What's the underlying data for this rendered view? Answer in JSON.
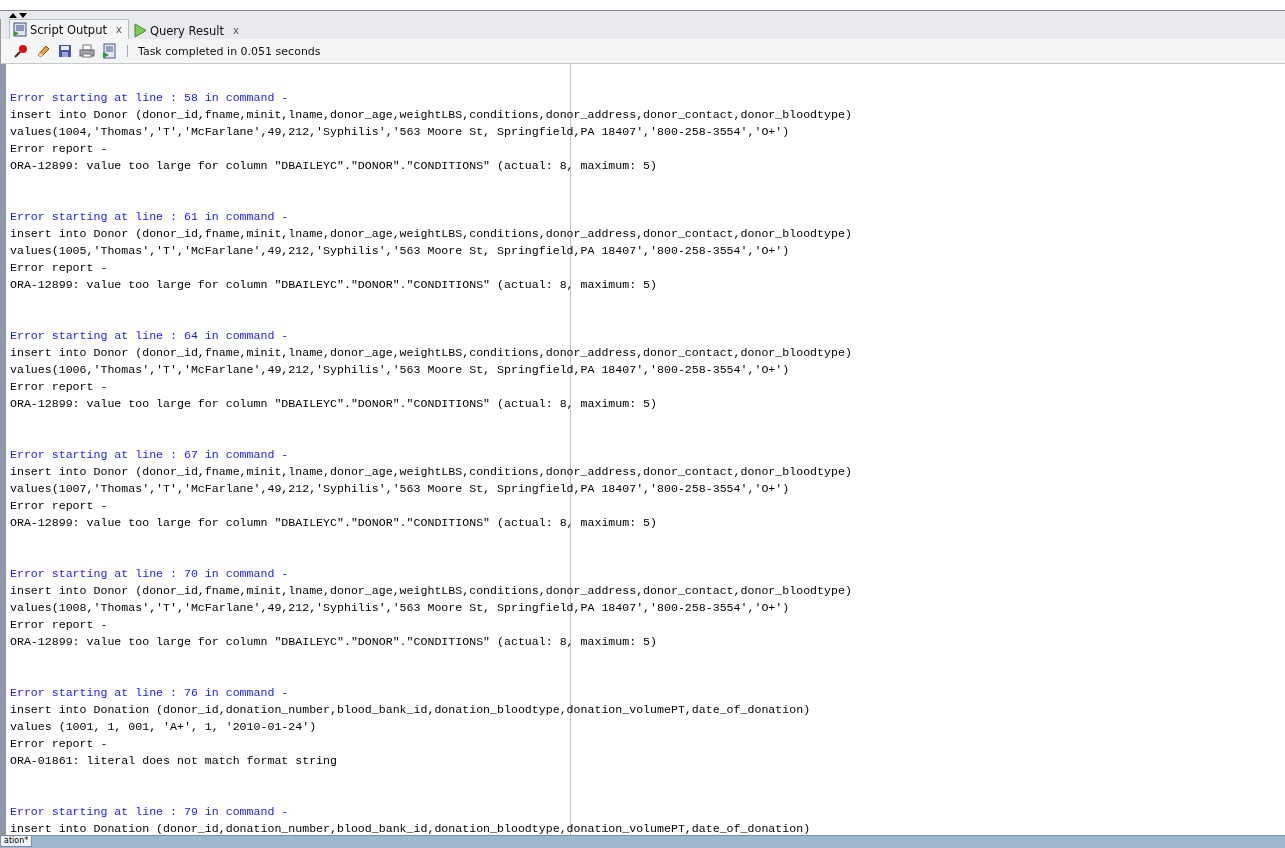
{
  "tabs": [
    {
      "label": "Script Output",
      "close": "x",
      "kind": "script",
      "selected": true
    },
    {
      "label": "Query Result",
      "close": "x",
      "kind": "play",
      "selected": false
    }
  ],
  "toolbar": {
    "tools": [
      {
        "kind": "pin"
      },
      {
        "kind": "eraser"
      },
      {
        "kind": "save"
      },
      {
        "kind": "print"
      },
      {
        "kind": "run"
      }
    ],
    "status": "Task completed in 0.051 seconds"
  },
  "output": [
    {
      "lines": [
        {
          "kind": "heading",
          "text": "Error starting at line : 58 in command -"
        },
        {
          "kind": "code",
          "text": "insert into Donor (donor_id,fname,minit,lname,donor_age,weightLBS,conditions,donor_address,donor_contact,donor_bloodtype)"
        },
        {
          "kind": "code",
          "text": "values(1004,'Thomas','T','McFarlane',49,212,'Syphilis','563 Moore St, Springfield,PA 18407','800-258-3554','O+')"
        },
        {
          "kind": "code",
          "text": "Error report -"
        },
        {
          "kind": "code",
          "text": "ORA-12899: value too large for column \"DBAILEYC\".\"DONOR\".\"CONDITIONS\" (actual: 8, maximum: 5)"
        }
      ]
    },
    {
      "lines": [
        {
          "kind": "heading",
          "text": "Error starting at line : 61 in command -"
        },
        {
          "kind": "code",
          "text": "insert into Donor (donor_id,fname,minit,lname,donor_age,weightLBS,conditions,donor_address,donor_contact,donor_bloodtype)"
        },
        {
          "kind": "code",
          "text": "values(1005,'Thomas','T','McFarlane',49,212,'Syphilis','563 Moore St, Springfield,PA 18407','800-258-3554','O+')"
        },
        {
          "kind": "code",
          "text": "Error report -"
        },
        {
          "kind": "code",
          "text": "ORA-12899: value too large for column \"DBAILEYC\".\"DONOR\".\"CONDITIONS\" (actual: 8, maximum: 5)"
        }
      ]
    },
    {
      "lines": [
        {
          "kind": "heading",
          "text": "Error starting at line : 64 in command -"
        },
        {
          "kind": "code",
          "text": "insert into Donor (donor_id,fname,minit,lname,donor_age,weightLBS,conditions,donor_address,donor_contact,donor_bloodtype)"
        },
        {
          "kind": "code",
          "text": "values(1006,'Thomas','T','McFarlane',49,212,'Syphilis','563 Moore St, Springfield,PA 18407','800-258-3554','O+')"
        },
        {
          "kind": "code",
          "text": "Error report -"
        },
        {
          "kind": "code",
          "text": "ORA-12899: value too large for column \"DBAILEYC\".\"DONOR\".\"CONDITIONS\" (actual: 8, maximum: 5)"
        }
      ]
    },
    {
      "lines": [
        {
          "kind": "heading",
          "text": "Error starting at line : 67 in command -"
        },
        {
          "kind": "code",
          "text": "insert into Donor (donor_id,fname,minit,lname,donor_age,weightLBS,conditions,donor_address,donor_contact,donor_bloodtype)"
        },
        {
          "kind": "code",
          "text": "values(1007,'Thomas','T','McFarlane',49,212,'Syphilis','563 Moore St, Springfield,PA 18407','800-258-3554','O+')"
        },
        {
          "kind": "code",
          "text": "Error report -"
        },
        {
          "kind": "code",
          "text": "ORA-12899: value too large for column \"DBAILEYC\".\"DONOR\".\"CONDITIONS\" (actual: 8, maximum: 5)"
        }
      ]
    },
    {
      "lines": [
        {
          "kind": "heading",
          "text": "Error starting at line : 70 in command -"
        },
        {
          "kind": "code",
          "text": "insert into Donor (donor_id,fname,minit,lname,donor_age,weightLBS,conditions,donor_address,donor_contact,donor_bloodtype)"
        },
        {
          "kind": "code",
          "text": "values(1008,'Thomas','T','McFarlane',49,212,'Syphilis','563 Moore St, Springfield,PA 18407','800-258-3554','O+')"
        },
        {
          "kind": "code",
          "text": "Error report -"
        },
        {
          "kind": "code",
          "text": "ORA-12899: value too large for column \"DBAILEYC\".\"DONOR\".\"CONDITIONS\" (actual: 8, maximum: 5)"
        }
      ]
    },
    {
      "lines": [
        {
          "kind": "heading",
          "text": "Error starting at line : 76 in command -"
        },
        {
          "kind": "code",
          "text": "insert into Donation (donor_id,donation_number,blood_bank_id,donation_bloodtype,donation_volumePT,date_of_donation)"
        },
        {
          "kind": "code",
          "text": "values (1001, 1, 001, 'A+', 1, '2010-01-24')"
        },
        {
          "kind": "code",
          "text": "Error report -"
        },
        {
          "kind": "code",
          "text": "ORA-01861: literal does not match format string"
        }
      ]
    },
    {
      "lines": [
        {
          "kind": "heading",
          "text": "Error starting at line : 79 in command -"
        },
        {
          "kind": "code",
          "text": "insert into Donation (donor_id,donation_number,blood_bank_id,donation_bloodtype,donation_volumePT,date_of_donation)"
        }
      ]
    }
  ],
  "taskbar": {
    "tab": "ation*"
  }
}
